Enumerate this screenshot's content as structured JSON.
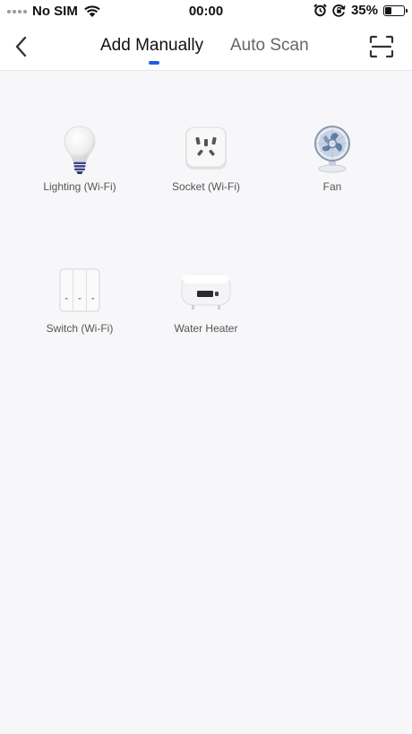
{
  "status_bar": {
    "carrier": "No SIM",
    "time": "00:00",
    "battery_percent_label": "35%",
    "battery_level": 0.35,
    "icons": [
      "signal-dots-icon",
      "wifi-icon",
      "alarm-icon",
      "rotation-lock-icon",
      "battery-icon"
    ]
  },
  "header": {
    "back_icon": "chevron-left-icon",
    "tabs": [
      {
        "label": "Add Manually",
        "active": true
      },
      {
        "label": "Auto Scan",
        "active": false
      }
    ],
    "scan_icon": "scan-frame-icon",
    "accent_color": "#1d5fe6"
  },
  "devices": [
    {
      "label": "Lighting (Wi-Fi)",
      "icon": "light-bulb-icon"
    },
    {
      "label": "Socket (Wi-Fi)",
      "icon": "socket-icon"
    },
    {
      "label": "Fan",
      "icon": "fan-icon"
    },
    {
      "label": "Switch (Wi-Fi)",
      "icon": "wall-switch-icon"
    },
    {
      "label": "Water Heater",
      "icon": "water-heater-icon"
    }
  ]
}
